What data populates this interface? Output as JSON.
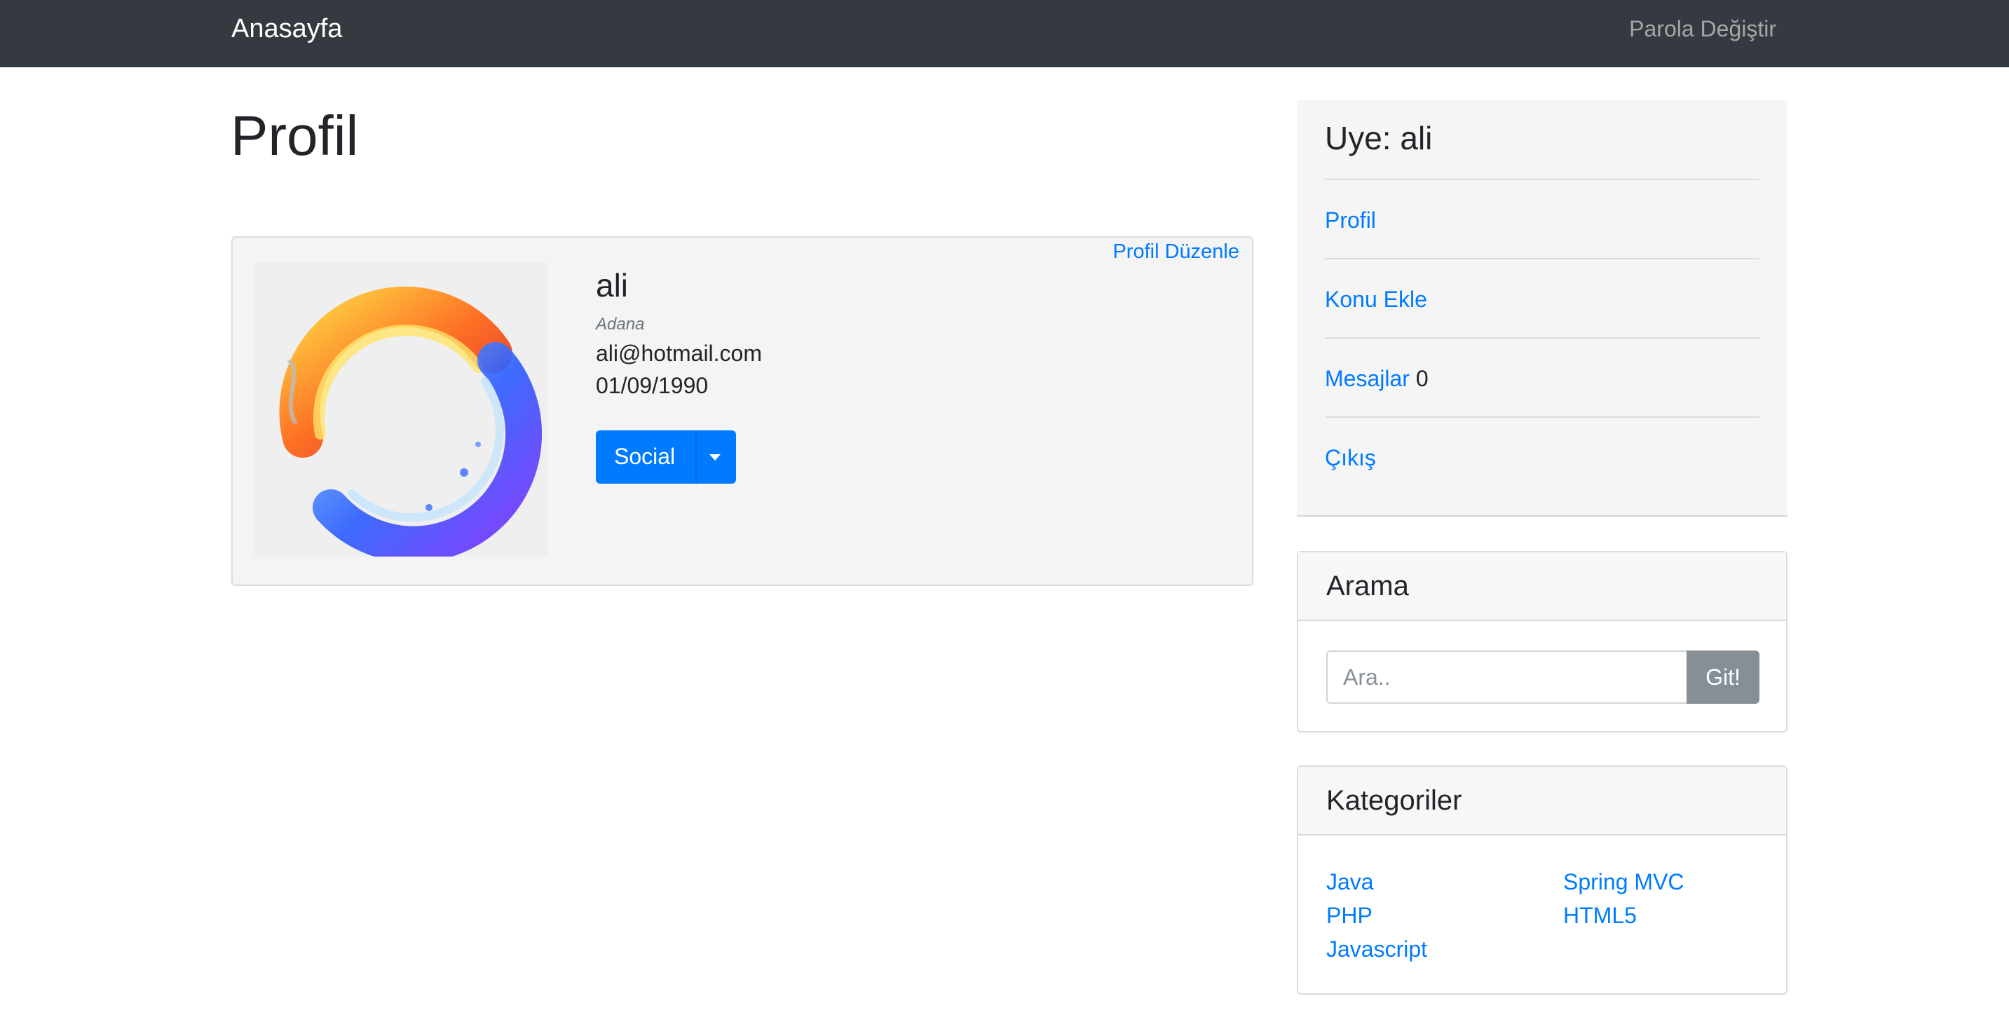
{
  "navbar": {
    "brand": "Anasayfa",
    "change_password": "Parola Değiştir"
  },
  "page": {
    "title": "Profil"
  },
  "profile": {
    "edit_link": "Profil Düzenle",
    "name": "ali",
    "city": "Adana",
    "email": "ali@hotmail.com",
    "birth_date": "01/09/1990",
    "social_button": "Social"
  },
  "member_panel": {
    "title": "Uye: ali",
    "items": [
      {
        "label": "Profil"
      },
      {
        "label": "Konu Ekle"
      },
      {
        "label": "Mesajlar",
        "count": "0"
      },
      {
        "label": "Çıkış"
      }
    ]
  },
  "search": {
    "title": "Arama",
    "placeholder": "Ara..",
    "button": "Git!"
  },
  "categories": {
    "title": "Kategoriler",
    "left": [
      "Java",
      "PHP",
      "Javascript"
    ],
    "right": [
      "Spring MVC",
      "HTML5"
    ]
  },
  "colors": {
    "navbar": "#343a40",
    "link": "#007bff",
    "primary": "#007bff",
    "secondary": "#868e96"
  }
}
